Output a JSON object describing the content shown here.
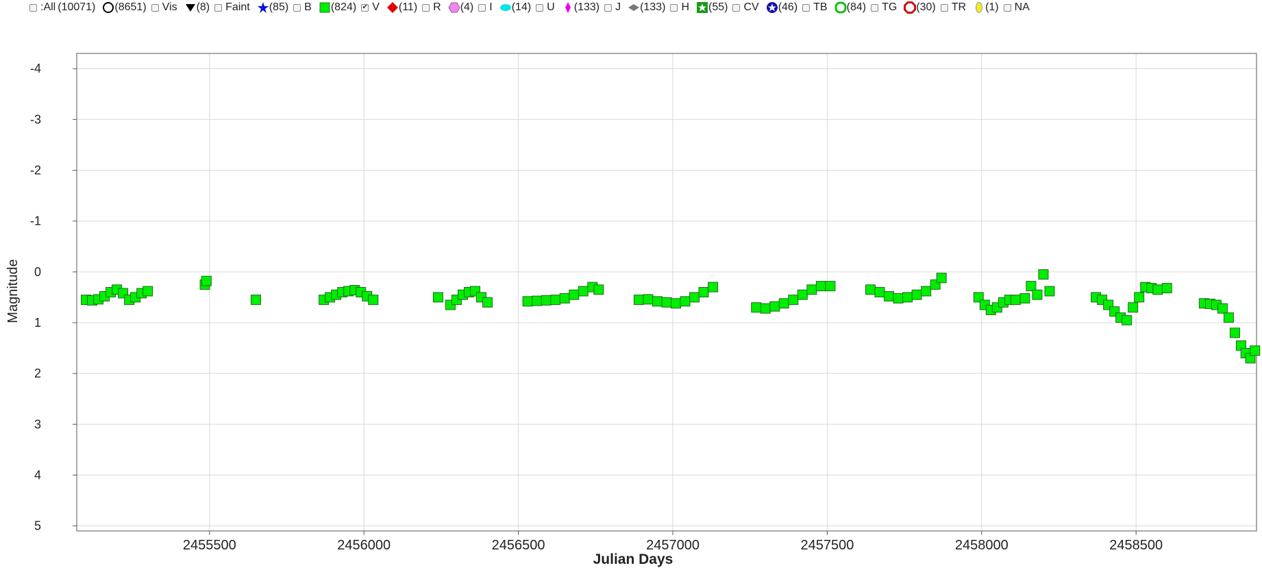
{
  "legend": {
    "all": {
      "label": ":All",
      "count": "(10071)"
    },
    "items": [
      {
        "count": "(8651)",
        "label": "Vis",
        "icon": "open-circle-icon",
        "color": "#000000",
        "checked": false
      },
      {
        "count": "(8)",
        "label": "Faint",
        "icon": "down-triangle-icon",
        "color": "#000000",
        "checked": false
      },
      {
        "count": "(85)",
        "label": "B",
        "icon": "star-icon",
        "color": "#1010e0",
        "checked": false
      },
      {
        "count": "(824)",
        "label": "V",
        "icon": "square-icon",
        "color": "#00ee00",
        "checked": true
      },
      {
        "count": "(11)",
        "label": "R",
        "icon": "diamond-icon",
        "color": "#e00000",
        "checked": false
      },
      {
        "count": "(4)",
        "label": "I",
        "icon": "hexagon-icon",
        "color": "#ee88ee",
        "checked": false
      },
      {
        "count": "(14)",
        "label": "U",
        "icon": "ellipse-icon",
        "color": "#00e5e5",
        "checked": false
      },
      {
        "count": "(133)",
        "label": "J",
        "icon": "thin-diamond-icon",
        "color": "#ee00ee",
        "checked": false
      },
      {
        "count": "(133)",
        "label": "H",
        "icon": "wide-diamond-icon",
        "color": "#777777",
        "checked": false
      },
      {
        "count": "(55)",
        "label": "CV",
        "icon": "square-star-icon",
        "color": "#1a9a1a",
        "checked": false
      },
      {
        "count": "(46)",
        "label": "TB",
        "icon": "ring-star-icon",
        "color": "#1010b0",
        "checked": false
      },
      {
        "count": "(84)",
        "label": "TG",
        "icon": "rounded-ring-icon",
        "color": "#10c010",
        "checked": false
      },
      {
        "count": "(30)",
        "label": "TR",
        "icon": "octagon-ring-icon",
        "color": "#d01010",
        "checked": false
      },
      {
        "count": "(1)",
        "label": "NA",
        "icon": "yellow-ellipse-icon",
        "color": "#eeee22",
        "checked": false
      }
    ]
  },
  "chart_data": {
    "type": "scatter",
    "xlabel": "Julian Days",
    "ylabel": "Magnitude",
    "xlim": [
      2455070,
      2458890
    ],
    "ylim": [
      -4.3,
      5.1
    ],
    "y_inverted": true,
    "xticks": [
      2455500,
      2456000,
      2456500,
      2457000,
      2457500,
      2458000,
      2458500
    ],
    "yticks": [
      -4,
      -3,
      -2,
      -1,
      0,
      1,
      2,
      3,
      4,
      5
    ],
    "grid": true,
    "series": [
      {
        "name": "V",
        "color": "#00ee00",
        "marker": "square",
        "x": [
          2455100,
          2455120,
          2455140,
          2455160,
          2455180,
          2455200,
          2455220,
          2455240,
          2455260,
          2455280,
          2455300,
          2455485,
          2455490,
          2455650,
          2455870,
          2455890,
          2455910,
          2455930,
          2455950,
          2455970,
          2455990,
          2456010,
          2456030,
          2456240,
          2456280,
          2456300,
          2456320,
          2456340,
          2456360,
          2456380,
          2456400,
          2456530,
          2456560,
          2456590,
          2456620,
          2456650,
          2456680,
          2456710,
          2456740,
          2456760,
          2456890,
          2456920,
          2456950,
          2456980,
          2457010,
          2457040,
          2457070,
          2457100,
          2457130,
          2457270,
          2457300,
          2457330,
          2457360,
          2457390,
          2457420,
          2457450,
          2457480,
          2457510,
          2457640,
          2457670,
          2457700,
          2457730,
          2457760,
          2457790,
          2457820,
          2457850,
          2457870,
          2457990,
          2458010,
          2458030,
          2458050,
          2458070,
          2458090,
          2458110,
          2458140,
          2458160,
          2458180,
          2458200,
          2458220,
          2458370,
          2458390,
          2458410,
          2458430,
          2458450,
          2458470,
          2458490,
          2458510,
          2458530,
          2458550,
          2458570,
          2458600,
          2458720,
          2458740,
          2458760,
          2458780,
          2458800,
          2458820,
          2458840,
          2458855,
          2458870,
          2458885
        ],
        "y": [
          0.55,
          0.56,
          0.54,
          0.48,
          0.4,
          0.35,
          0.42,
          0.55,
          0.5,
          0.42,
          0.38,
          0.25,
          0.18,
          0.55,
          0.55,
          0.5,
          0.45,
          0.4,
          0.38,
          0.36,
          0.4,
          0.48,
          0.55,
          0.5,
          0.65,
          0.55,
          0.45,
          0.4,
          0.38,
          0.5,
          0.6,
          0.58,
          0.57,
          0.56,
          0.55,
          0.52,
          0.45,
          0.38,
          0.3,
          0.35,
          0.55,
          0.54,
          0.58,
          0.6,
          0.62,
          0.58,
          0.5,
          0.4,
          0.3,
          0.7,
          0.72,
          0.68,
          0.62,
          0.55,
          0.45,
          0.35,
          0.28,
          0.28,
          0.35,
          0.4,
          0.48,
          0.52,
          0.5,
          0.45,
          0.38,
          0.25,
          0.12,
          0.5,
          0.65,
          0.75,
          0.7,
          0.6,
          0.55,
          0.55,
          0.52,
          0.28,
          0.45,
          0.05,
          0.38,
          0.5,
          0.55,
          0.65,
          0.78,
          0.9,
          0.95,
          0.7,
          0.5,
          0.3,
          0.32,
          0.35,
          0.32,
          0.62,
          0.63,
          0.65,
          0.72,
          0.9,
          1.2,
          1.45,
          1.6,
          1.7,
          1.55
        ]
      }
    ]
  }
}
